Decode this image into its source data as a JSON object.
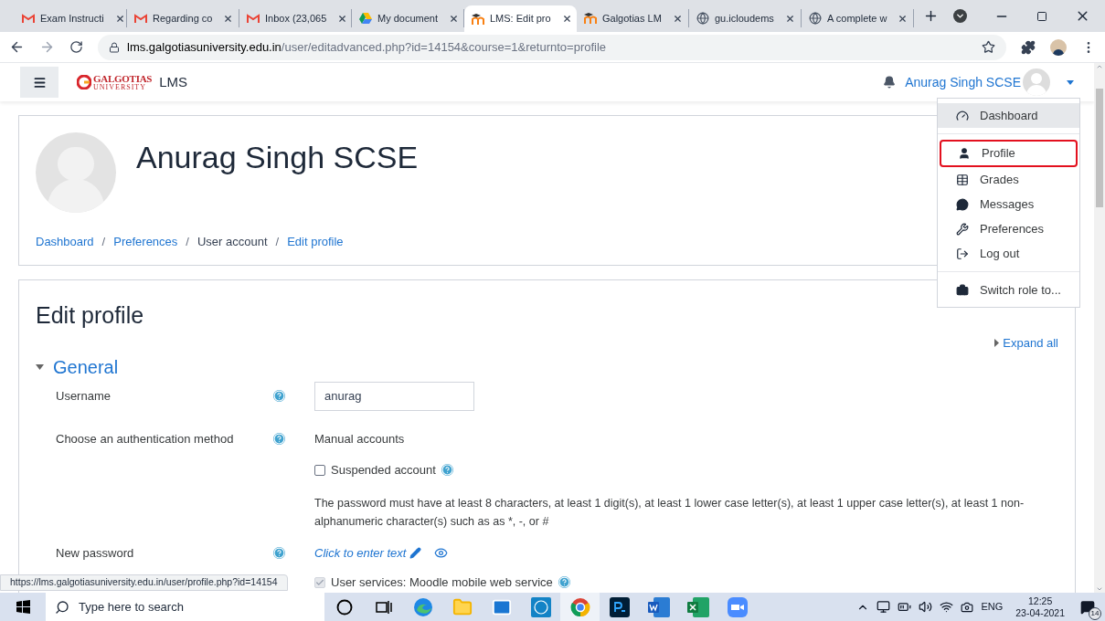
{
  "browser": {
    "tabs": [
      {
        "title": "Exam Instructi",
        "kind": "gmail",
        "selected": false
      },
      {
        "title": "Regarding co",
        "kind": "gmail",
        "selected": false
      },
      {
        "title": "Inbox (23,065",
        "kind": "gmail",
        "selected": false
      },
      {
        "title": "My document",
        "kind": "drive",
        "selected": false
      },
      {
        "title": "LMS: Edit pro",
        "kind": "moodle",
        "selected": true
      },
      {
        "title": "Galgotias LM",
        "kind": "moodle",
        "selected": false
      },
      {
        "title": "gu.icloudems",
        "kind": "globe",
        "selected": false
      },
      {
        "title": "A complete w",
        "kind": "globe",
        "selected": false
      }
    ],
    "url_domain": "lms.galgotiasuniversity.edu.in",
    "url_path": "/user/editadvanced.php?id=14154&course=1&returnto=profile",
    "status_link": "https://lms.galgotiasuniversity.edu.in/user/profile.php?id=14154"
  },
  "navbar": {
    "logo_top": "GALGOTIAS",
    "logo_bottom": "UNIVERSITY",
    "site": "LMS",
    "user": "Anurag Singh SCSE"
  },
  "user_menu": [
    {
      "label": "Dashboard",
      "kind": "dashboard",
      "selected": true,
      "outlined": false,
      "divider_after": true
    },
    {
      "label": "Profile",
      "kind": "user",
      "selected": false,
      "outlined": true,
      "divider_after": false
    },
    {
      "label": "Grades",
      "kind": "table",
      "selected": false,
      "outlined": false,
      "divider_after": false
    },
    {
      "label": "Messages",
      "kind": "comment",
      "selected": false,
      "outlined": false,
      "divider_after": false
    },
    {
      "label": "Preferences",
      "kind": "wrench",
      "selected": false,
      "outlined": false,
      "divider_after": false
    },
    {
      "label": "Log out",
      "kind": "logout",
      "selected": false,
      "outlined": false,
      "divider_after": true
    },
    {
      "label": "Switch role to...",
      "kind": "role",
      "selected": false,
      "outlined": false,
      "divider_after": false
    }
  ],
  "header": {
    "name": "Anurag Singh SCSE",
    "breadcrumb": [
      {
        "label": "Dashboard",
        "link": true
      },
      {
        "separator": "/",
        "label": "Preferences",
        "link": true
      },
      {
        "separator": "/",
        "label": "User account",
        "link": false
      },
      {
        "separator": "/",
        "label": "Edit profile",
        "link": true
      }
    ]
  },
  "form": {
    "title": "Edit profile",
    "expand_all": "Expand all",
    "section": "General",
    "expanded": true,
    "rows": [
      {
        "kind": "input",
        "label": "Username",
        "help": true,
        "value": "anurag"
      },
      {
        "kind": "static",
        "label": "Choose an authentication method",
        "help": true,
        "value": "Manual accounts"
      },
      {
        "kind": "checkbox",
        "label": "Suspended account",
        "help": true,
        "checked": false,
        "disabled": false
      },
      {
        "kind": "note",
        "text": "The password must have at least 8 characters, at least 1 digit(s), at least 1 lower case letter(s), at least 1 upper case letter(s), at least 1 non-alphanumeric character(s) such as as *, -, or #"
      },
      {
        "kind": "password",
        "label": "New password",
        "help": true,
        "value": "Click to enter text"
      },
      {
        "kind": "checkbox",
        "label": "User services: Moodle mobile web service",
        "help": true,
        "checked": true,
        "disabled": true
      }
    ]
  },
  "taskbar": {
    "search": "Type here to search",
    "apps": [
      {
        "kind": "cortana",
        "selected": false
      },
      {
        "kind": "taskview",
        "selected": false
      },
      {
        "kind": "edge",
        "selected": false
      },
      {
        "kind": "folder",
        "selected": false
      },
      {
        "kind": "mail",
        "selected": false
      },
      {
        "kind": "dell",
        "selected": false
      },
      {
        "kind": "chrome",
        "selected": true
      },
      {
        "kind": "ps",
        "selected": false
      },
      {
        "kind": "word",
        "selected": false
      },
      {
        "kind": "excel",
        "selected": false
      },
      {
        "kind": "zoom",
        "selected": false
      }
    ],
    "lang": "ENG",
    "time": "12:25",
    "date": "23-04-2021",
    "notifications": "14"
  }
}
